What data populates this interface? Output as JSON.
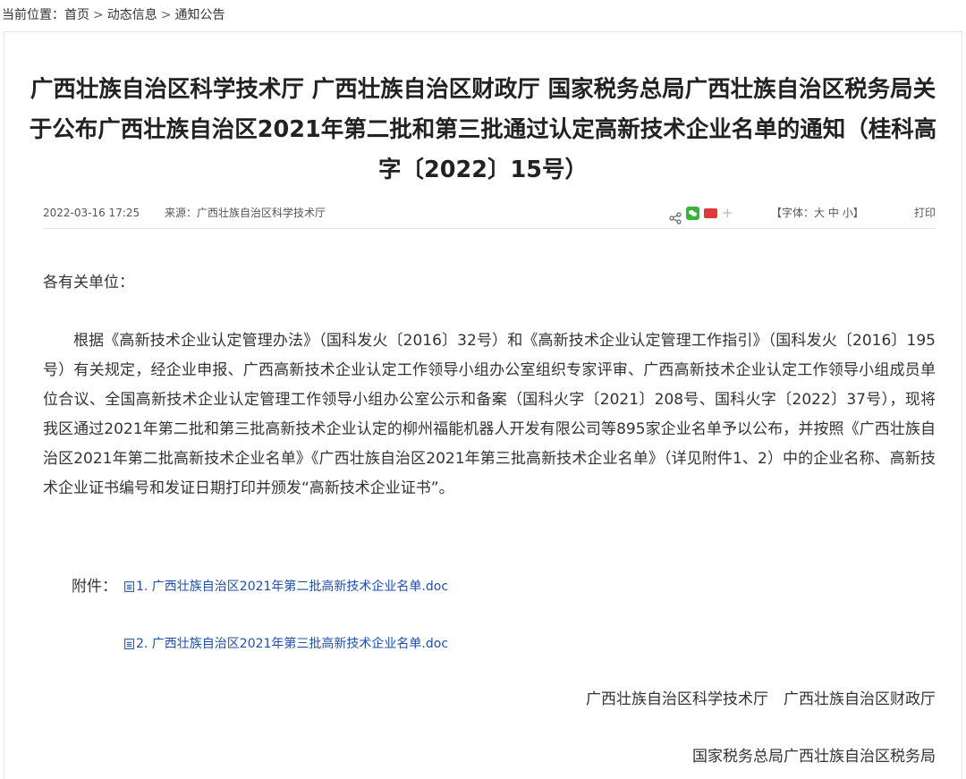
{
  "breadcrumb": {
    "prefix": "当前位置：",
    "items": [
      "首页",
      "动态信息",
      "通知公告"
    ],
    "separator": ">"
  },
  "article": {
    "title": "广西壮族自治区科学技术厅 广西壮族自治区财政厅 国家税务总局广西壮族自治区税务局关于公布广西壮族自治区2021年第二批和第三批通过认定高新技术企业名单的通知（桂科高字〔2022〕15号）",
    "date": "2022-03-16 17:25",
    "source": "来源：广西壮族自治区科学技术厅",
    "share_icons": [
      "share-icon",
      "wechat-icon",
      "weibo-icon",
      "plus-icon"
    ],
    "font_size": {
      "prefix": "【字体：",
      "large": "大",
      "medium": "中",
      "small": "小",
      "suffix": "】"
    },
    "print": "打印",
    "greeting": "各有关单位：",
    "paragraph": "根据《高新技术企业认定管理办法》（国科发火〔2016〕32号）和《高新技术企业认定管理工作指引》（国科发火〔2016〕195号）有关规定，经企业申报、广西高新技术企业认定工作领导小组办公室组织专家评审、广西高新技术企业认定工作领导小组成员单位合议、全国高新技术企业认定管理工作领导小组办公室公示和备案（国科火字〔2021〕208号、国科火字〔2022〕37号），现将我区通过2021年第二批和第三批高新技术企业认定的柳州福能机器人开发有限公司等895家企业名单予以公布，并按照《广西壮族自治区2021年第二批高新技术企业名单》《广西壮族自治区2021年第三批高新技术企业名单》（详见附件1、2）中的企业名称、高新技术企业证书编号和发证日期打印并颁发“高新技术企业证书”。",
    "attachments_label": "附件：",
    "attachments": [
      "1. 广西壮族自治区2021年第二批高新技术企业名单.doc",
      "2. 广西壮族自治区2021年第三批高新技术企业名单.doc"
    ],
    "signature_line1": "广西壮族自治区科学技术厅　广西壮族自治区财政厅",
    "signature_line2": "国家税务总局广西壮族自治区税务局"
  },
  "colors": {
    "link": "#1f4fa8",
    "text": "#333333",
    "wechat": "#3bb33b",
    "weibo": "#e0393a"
  }
}
